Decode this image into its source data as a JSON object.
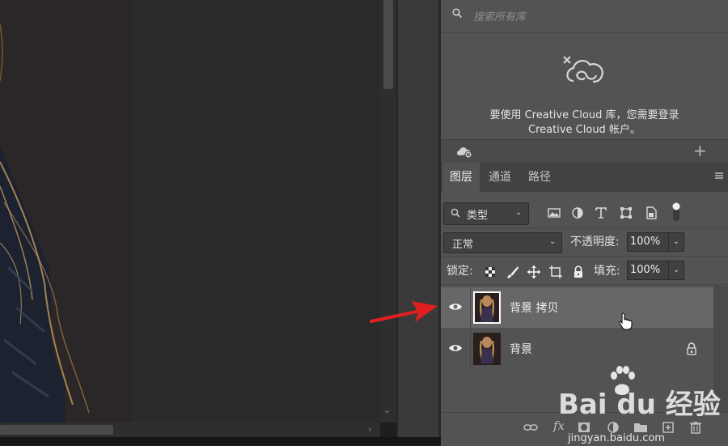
{
  "library": {
    "search_placeholder": "搜索所有库",
    "message_line1": "要使用 Creative Cloud 库，您需要登录",
    "message_line2": "Creative Cloud 帐户。"
  },
  "layers_panel": {
    "tabs": [
      {
        "label": "图层",
        "active": true
      },
      {
        "label": "通道",
        "active": false
      },
      {
        "label": "路径",
        "active": false
      }
    ],
    "filter_kind": "类型",
    "blend_mode": "正常",
    "opacity_label": "不透明度:",
    "opacity_value": "100%",
    "lock_label": "锁定:",
    "fill_label": "填充:",
    "fill_value": "100%",
    "layers": [
      {
        "name": "背景 拷贝",
        "visible": true,
        "selected": true,
        "locked": false
      },
      {
        "name": "背景",
        "visible": true,
        "selected": false,
        "locked": true
      }
    ],
    "fx_label": "fx"
  },
  "watermark": {
    "brand": "Bai du 经验",
    "url": "jingyan.baidu.com"
  },
  "colors": {
    "panel_bg": "#535353",
    "selected_row": "#676767",
    "arrow_red": "#e02020"
  }
}
